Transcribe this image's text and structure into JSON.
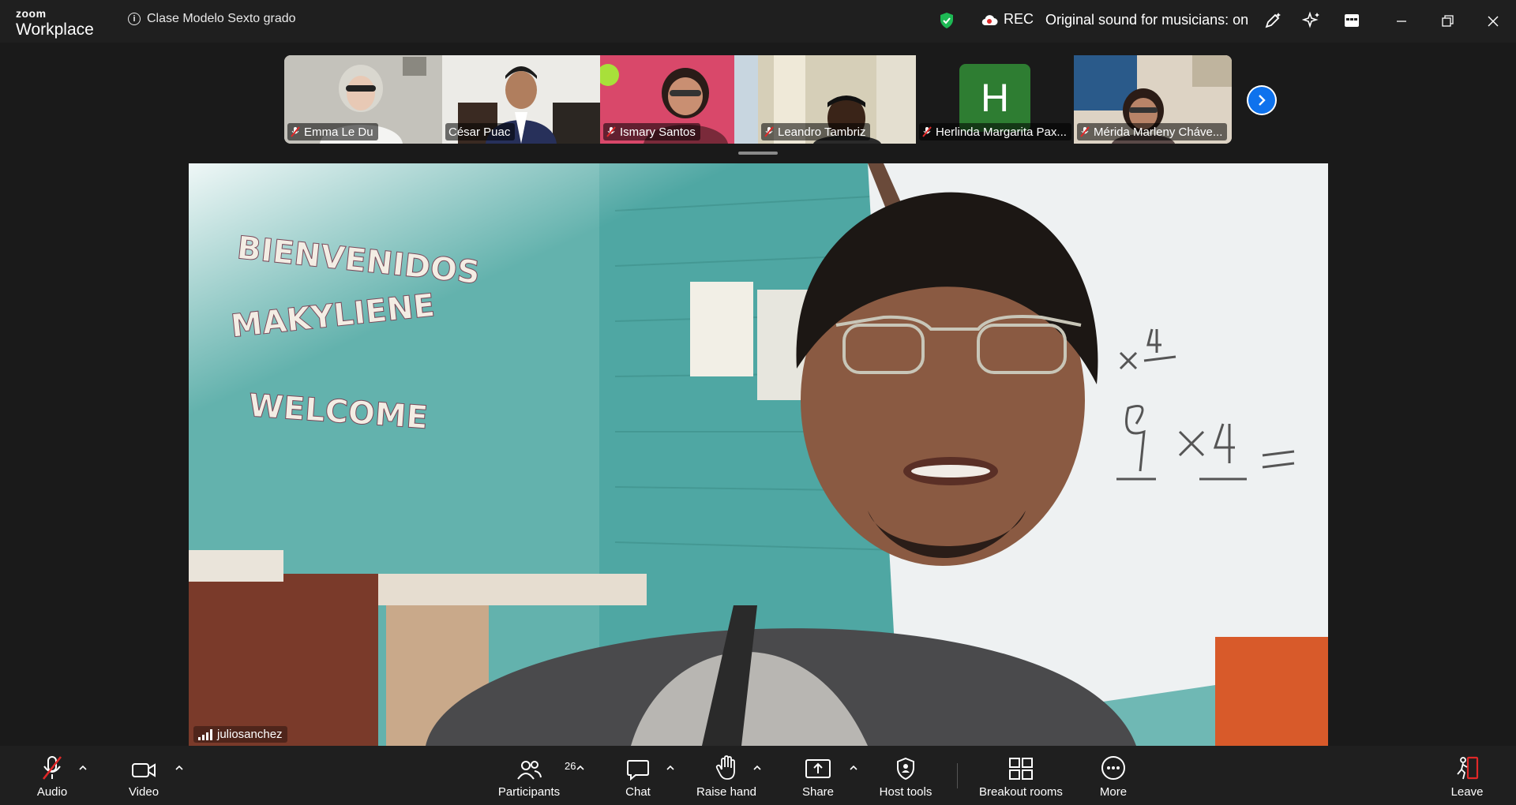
{
  "app": {
    "logo_top": "zoom",
    "logo_bottom": "Workplace",
    "meeting_title": "Clase Modelo Sexto grado",
    "rec_label": "REC",
    "original_sound": "Original sound for musicians: on"
  },
  "participants_strip": [
    {
      "name": "Emma Le Du",
      "bg": "#b9b7b0",
      "type": "video"
    },
    {
      "name": "César Puac",
      "bg": "#e8e6e2",
      "type": "video"
    },
    {
      "name": "Ismary Santos",
      "bg": "#d94a6a",
      "type": "video"
    },
    {
      "name": "Leandro Tambriz",
      "bg": "#c9c0a6",
      "type": "video"
    },
    {
      "name": "Herlinda Margarita Pax...",
      "bg": "#1a1a1a",
      "type": "avatar",
      "initial": "H",
      "avatar_color": "#2e7d32"
    },
    {
      "name": "Mérida Marleny Cháve...",
      "bg": "#d8cfc2",
      "type": "video"
    }
  ],
  "main_speaker": {
    "name": "juliosanchez"
  },
  "toolbar": {
    "audio": "Audio",
    "video": "Video",
    "participants": "Participants",
    "participants_count": "26",
    "chat": "Chat",
    "raise_hand": "Raise hand",
    "share": "Share",
    "host_tools": "Host tools",
    "breakout_rooms": "Breakout rooms",
    "more": "More",
    "leave": "Leave"
  },
  "colors": {
    "accent_blue": "#0e72ed",
    "shield_green": "#1db954",
    "leave_red": "#e02828",
    "mute_red": "#e02828"
  },
  "icons": {
    "info": "info-icon",
    "shield": "shield-icon",
    "rec": "cloud-record-icon",
    "next": "chevron-right-icon"
  }
}
